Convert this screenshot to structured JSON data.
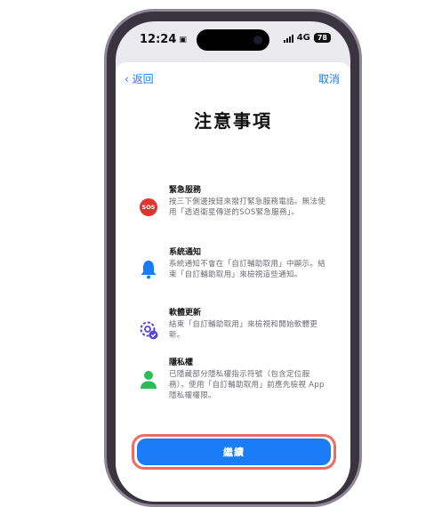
{
  "status": {
    "time": "12:24",
    "network": "4G",
    "battery": "78"
  },
  "nav": {
    "back_label": "返回",
    "cancel_label": "取消"
  },
  "title": "注意事項",
  "items": [
    {
      "title": "緊急服務",
      "body": "按三下側邊按鈕來撥打緊急服務電話。無法使用「透過衛星傳送的SOS緊急服務」。",
      "icon": "sos-icon",
      "icon_text": "SOS"
    },
    {
      "title": "系統通知",
      "body": "系統通知不會在「自訂輔助取用」中顯示。結束「自訂輔助取用」來檢視這些通知。",
      "icon": "bell-icon"
    },
    {
      "title": "軟體更新",
      "body": "結束「自訂輔助取用」來檢視和開始軟體更新。",
      "icon": "software-update-gear-icon"
    },
    {
      "title": "隱私權",
      "body": "已隱藏部分隱私權指示符號（包含定位服務）。使用「自訂輔助取用」前應先檢視 App 隱私權權限。",
      "icon": "person-icon"
    }
  ],
  "continue_label": "繼續",
  "colors": {
    "accent": "#1a7cf6",
    "sos": "#e0342f",
    "success": "#2dbb5a",
    "purple": "#5b45d6",
    "highlight": "#f06a63"
  }
}
